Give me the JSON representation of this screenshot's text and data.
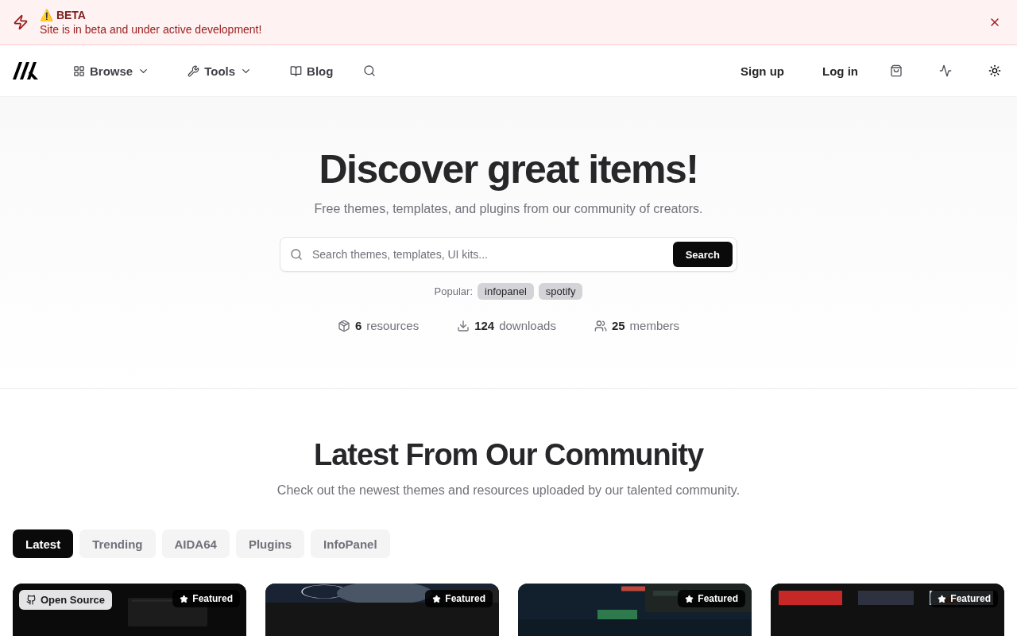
{
  "banner": {
    "title": "⚠️ BETA",
    "message": "Site is in beta and under active development!"
  },
  "nav": {
    "items": [
      {
        "label": "Browse",
        "dropdown": true
      },
      {
        "label": "Tools",
        "dropdown": true
      },
      {
        "label": "Blog",
        "dropdown": false
      }
    ],
    "actions": [
      "Sign up",
      "Log in"
    ]
  },
  "hero": {
    "title": "Discover great items!",
    "subtitle": "Free themes, templates, and plugins from our community of creators.",
    "search": {
      "placeholder": "Search themes, templates, UI kits...",
      "button": "Search"
    },
    "popular_label": "Popular:",
    "popular": [
      "infopanel",
      "spotify"
    ],
    "stats": [
      {
        "value": "6",
        "label": "resources"
      },
      {
        "value": "124",
        "label": "downloads"
      },
      {
        "value": "25",
        "label": "members"
      }
    ]
  },
  "community": {
    "title": "Latest From Our Community",
    "subtitle": "Check out the newest themes and resources uploaded by our talented community.",
    "tabs": [
      {
        "label": "Latest",
        "selected": true
      },
      {
        "label": "Trending",
        "selected": false
      },
      {
        "label": "AIDA64",
        "selected": false
      },
      {
        "label": "Plugins",
        "selected": false
      },
      {
        "label": "InfoPanel",
        "selected": false
      }
    ],
    "cards": [
      {
        "kind": "picture",
        "tag": "Open Source",
        "featured": "Featured"
      },
      {
        "kind": "picture",
        "featured": "Featured"
      },
      {
        "kind": "picture",
        "featured": "Featured"
      },
      {
        "kind": "picture",
        "featured": "Featured"
      }
    ]
  }
}
